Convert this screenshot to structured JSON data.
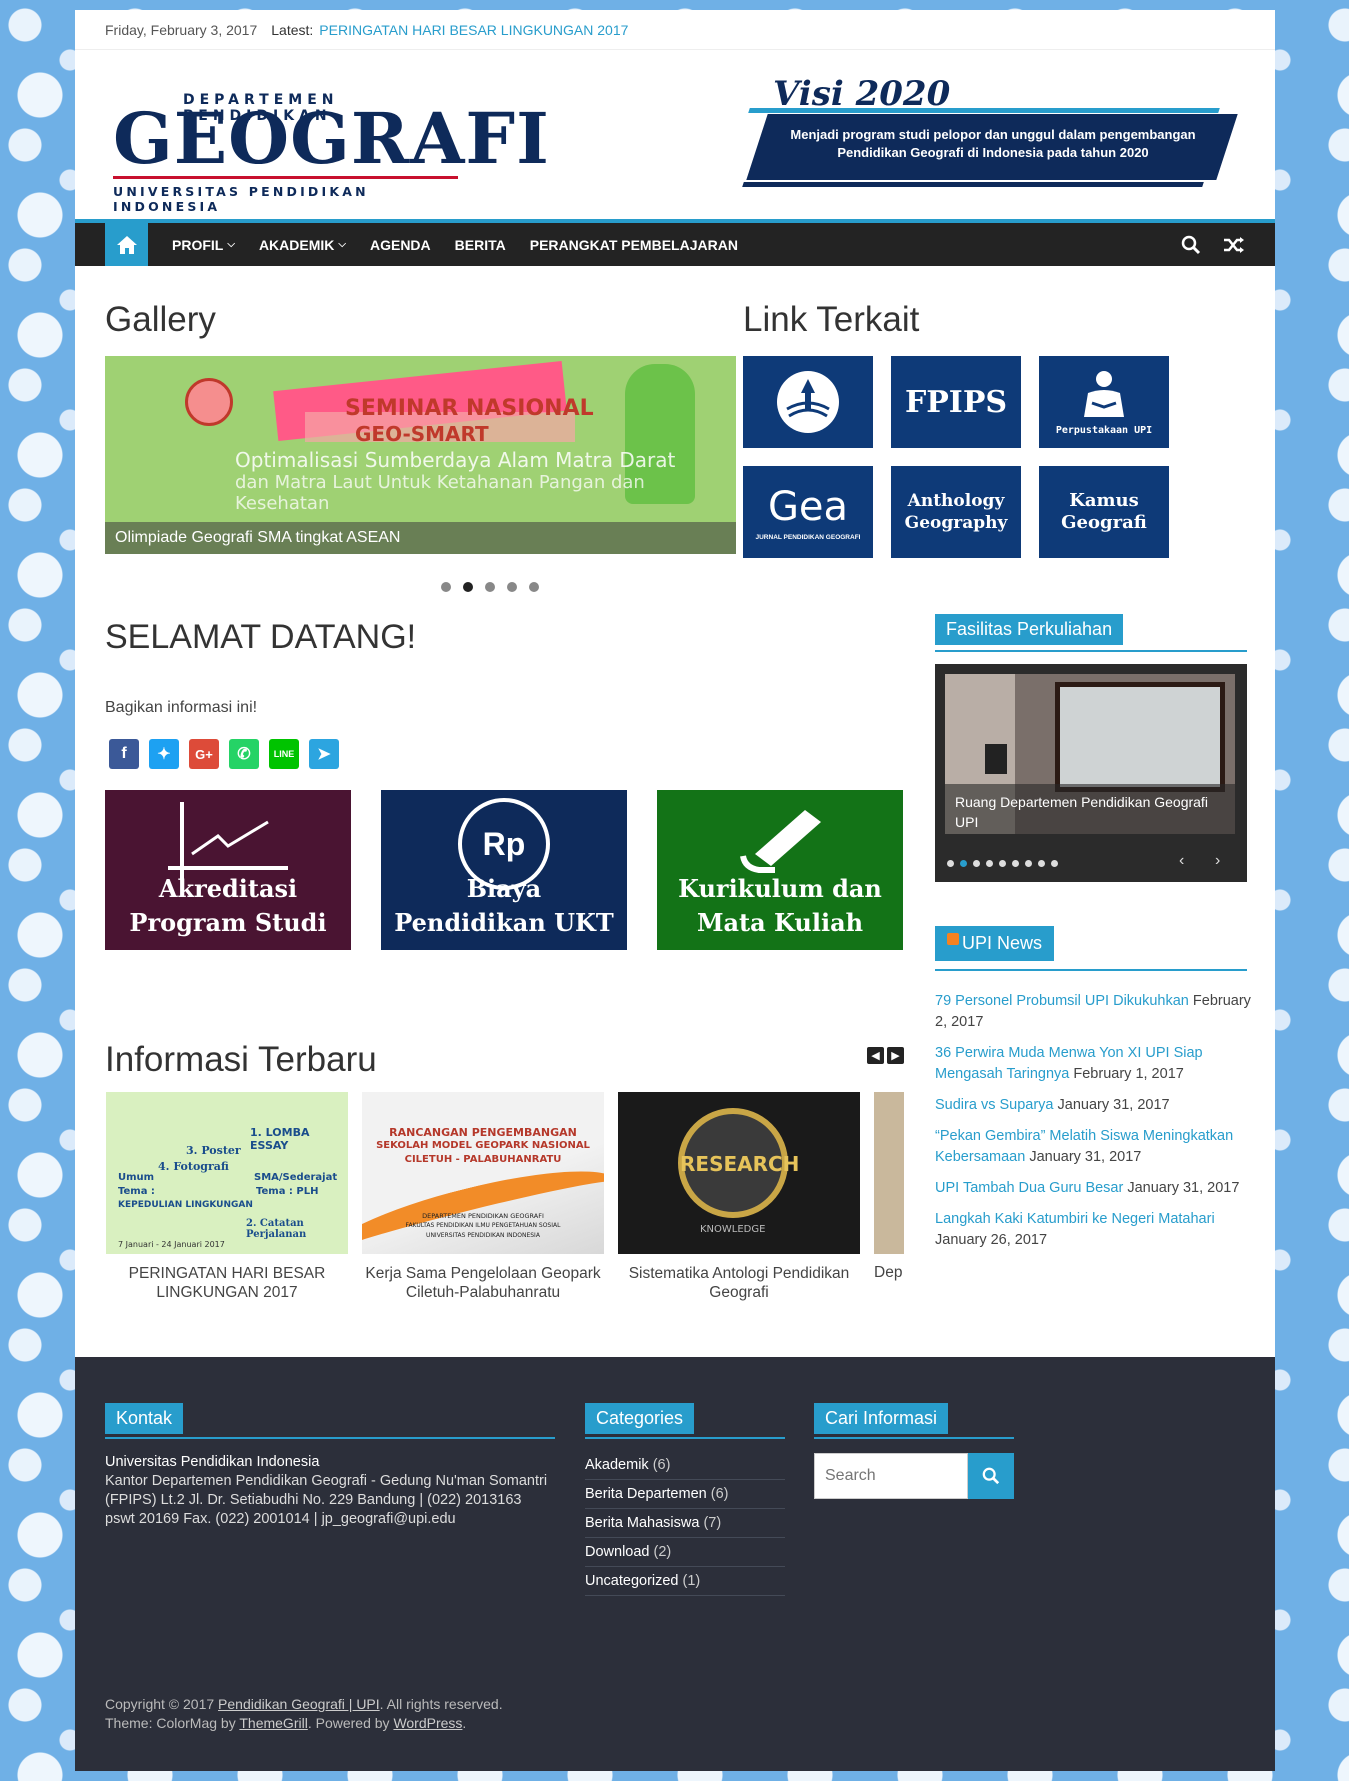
{
  "topbar": {
    "date": "Friday, February 3, 2017",
    "latest_label": "Latest:",
    "latest_link": "PERINGATAN HARI BESAR LINGKUNGAN 2017"
  },
  "header": {
    "logo_line1": "DEPARTEMEN PENDIDIKAN",
    "logo_line2": "GEOGRAFI",
    "logo_line3": "UNIVERSITAS PENDIDIKAN INDONESIA",
    "visi_title": "Visi 2020",
    "visi_text": "Menjadi program studi pelopor dan unggul dalam pengembangan Pendidikan Geografi di Indonesia pada tahun 2020"
  },
  "nav": {
    "items": [
      {
        "label": "PROFIL",
        "dropdown": true
      },
      {
        "label": "AKADEMIK",
        "dropdown": true
      },
      {
        "label": "AGENDA",
        "dropdown": false
      },
      {
        "label": "BERITA",
        "dropdown": false
      },
      {
        "label": "PERANGKAT PEMBELAJARAN",
        "dropdown": false
      }
    ]
  },
  "gallery": {
    "title": "Gallery",
    "slide_texts": [
      "SEMINAR NASIONAL",
      "GEO-SMART",
      "Optimalisasi Sumberdaya Alam Matra Darat",
      "dan Matra Laut Untuk Ketahanan Pangan dan Kesehatan"
    ],
    "caption": "Olimpiade Geografi SMA tingkat ASEAN",
    "dots": 5,
    "active_dot": 2
  },
  "links": {
    "title": "Link Terkait",
    "tiles": [
      {
        "label": "",
        "sub": ""
      },
      {
        "label": "FPIPS",
        "sub": ""
      },
      {
        "label": "",
        "sub": "Perpustakaan UPI"
      },
      {
        "label": "Gea",
        "sub": "JURNAL PENDIDIKAN GEOGRAFI"
      },
      {
        "label": "Anthology Geography",
        "sub": ""
      },
      {
        "label": "Kamus Geografi",
        "sub": ""
      }
    ]
  },
  "welcome": {
    "title": "SELAMAT DATANG!",
    "share_label": "Bagikan informasi ini!",
    "cards": [
      {
        "line1": "Akreditasi",
        "line2": "Program Studi",
        "color": "#4a1432"
      },
      {
        "line1": "Biaya",
        "line2": "Pendidikan UKT",
        "color": "#0e2a5a"
      },
      {
        "line1": "Kurikulum dan",
        "line2": "Mata Kuliah",
        "color": "#137317"
      }
    ],
    "rp": "Rp"
  },
  "info": {
    "title": "Informasi Terbaru",
    "posts": [
      {
        "title": "PERINGATAN HARI BESAR LINGKUNGAN 2017"
      },
      {
        "title": "Kerja Sama Pengelolaan Geopark Ciletuh-Palabuhanratu"
      },
      {
        "title": "Sistematika Antologi Pendidikan Geografi"
      },
      {
        "title": "Dep"
      }
    ],
    "post1_texts": [
      "1. LOMBA ESSAY",
      "3. Poster",
      "4. Fotografi",
      "SMA/Sederajat",
      "Tema : PLH",
      "Umum",
      "Tema :",
      "KEPEDULIAN LINGKUNGAN",
      "2. Catatan Perjalanan",
      "7 Januari - 24 Januari 2017"
    ],
    "post2_texts": [
      "RANCANGAN PENGEMBANGAN",
      "SEKOLAH MODEL GEOPARK NASIONAL",
      "CILETUH - PALABUHANRATU",
      "DEPARTEMEN PENDIDIKAN GEOGRAFI",
      "FAKULTAS PENDIDIKAN ILMU PENGETAHUAN SOSIAL",
      "UNIVERSITAS PENDIDIKAN INDONESIA"
    ],
    "post3_texts": [
      "RESEARCH",
      "KNOWLEDGE"
    ]
  },
  "sidebar": {
    "fasilitas_title": "Fasilitas Perkuliahan",
    "fasilitas_caption": "Ruang Departemen Pendidikan Geografi UPI",
    "fasilitas_dots": 9,
    "news_title": "UPI News",
    "news": [
      {
        "title": "79 Personel Probumsil UPI Dikukuhkan",
        "date": "February 2, 2017"
      },
      {
        "title": "36 Perwira Muda Menwa Yon XI UPI Siap Mengasah Taringnya",
        "date": "February 1, 2017"
      },
      {
        "title": "Sudira vs Suparya",
        "date": "January 31, 2017"
      },
      {
        "title": "“Pekan Gembira” Melatih Siswa Meningkatkan Kebersamaan",
        "date": "January 31, 2017"
      },
      {
        "title": "UPI Tambah Dua Guru Besar",
        "date": "January 31, 2017"
      },
      {
        "title": "Langkah Kaki Katumbiri ke Negeri Matahari",
        "date": "January 26, 2017"
      }
    ]
  },
  "footer": {
    "kontak_title": "Kontak",
    "kontak_name": "Universitas Pendidikan Indonesia",
    "kontak_address": "Kantor Departemen Pendidikan Geografi - Gedung Nu'man Somantri (FPIPS) Lt.2 Jl. Dr. Setiabudhi No. 229 Bandung | (022) 2013163 pswt 20169 Fax. (022) 2001014 | jp_geografi@upi.edu",
    "categories_title": "Categories",
    "categories": [
      {
        "name": "Akademik",
        "count": "(6)"
      },
      {
        "name": "Berita Departemen",
        "count": "(6)"
      },
      {
        "name": "Berita Mahasiswa",
        "count": "(7)"
      },
      {
        "name": "Download",
        "count": "(2)"
      },
      {
        "name": "Uncategorized",
        "count": "(1)"
      }
    ],
    "cari_title": "Cari Informasi",
    "search_placeholder": "Search",
    "copy1_prefix": "Copyright © 2017 ",
    "copy1_link": "Pendidikan Geografi | UPI",
    "copy1_suffix": ". All rights reserved.",
    "copy2_prefix": "Theme: ColorMag by ",
    "copy2_link1": "ThemeGrill",
    "copy2_mid": ". Powered by ",
    "copy2_link2": "WordPress",
    "copy2_suffix": "."
  },
  "colors": {
    "accent": "#289dcc",
    "nav": "#232323",
    "footer": "#2c2f3a",
    "navy": "#0e2a5a"
  }
}
